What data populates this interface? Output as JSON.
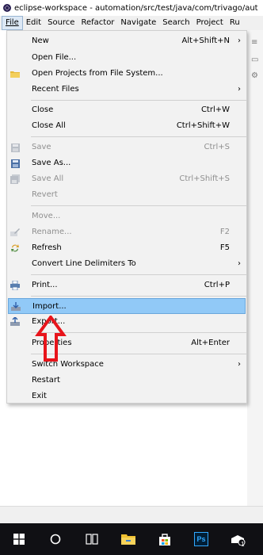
{
  "window": {
    "title": "eclipse-workspace - automation/src/test/java/com/trivago/aut"
  },
  "menubar": {
    "items": [
      "File",
      "Edit",
      "Source",
      "Refactor",
      "Navigate",
      "Search",
      "Project",
      "Ru"
    ]
  },
  "file_menu": {
    "items": [
      {
        "label": "New",
        "shortcut": "Alt+Shift+N",
        "submenu": true,
        "enabled": true
      },
      {
        "label": "Open File...",
        "shortcut": "",
        "enabled": true
      },
      {
        "label": "Open Projects from File System...",
        "shortcut": "",
        "enabled": true,
        "icon": "folder-icon"
      },
      {
        "label": "Recent Files",
        "shortcut": "",
        "submenu": true,
        "enabled": true
      },
      {
        "label": "Close",
        "shortcut": "Ctrl+W",
        "enabled": true
      },
      {
        "label": "Close All",
        "shortcut": "Ctrl+Shift+W",
        "enabled": true
      },
      {
        "label": "Save",
        "shortcut": "Ctrl+S",
        "enabled": false,
        "icon": "save-icon"
      },
      {
        "label": "Save As...",
        "shortcut": "",
        "enabled": true,
        "icon": "save-as-icon"
      },
      {
        "label": "Save All",
        "shortcut": "Ctrl+Shift+S",
        "enabled": false,
        "icon": "save-all-icon"
      },
      {
        "label": "Revert",
        "shortcut": "",
        "enabled": false
      },
      {
        "label": "Move...",
        "shortcut": "",
        "enabled": false
      },
      {
        "label": "Rename...",
        "shortcut": "F2",
        "enabled": false,
        "icon": "rename-icon"
      },
      {
        "label": "Refresh",
        "shortcut": "F5",
        "enabled": true,
        "icon": "refresh-icon"
      },
      {
        "label": "Convert Line Delimiters To",
        "shortcut": "",
        "submenu": true,
        "enabled": true
      },
      {
        "label": "Print...",
        "shortcut": "Ctrl+P",
        "enabled": true,
        "icon": "print-icon"
      },
      {
        "label": "Import...",
        "shortcut": "",
        "enabled": true,
        "highlighted": true,
        "icon": "import-icon"
      },
      {
        "label": "Export...",
        "shortcut": "",
        "enabled": true,
        "icon": "export-icon"
      },
      {
        "label": "Properties",
        "shortcut": "Alt+Enter",
        "enabled": true
      },
      {
        "label": "Switch Workspace",
        "shortcut": "",
        "submenu": true,
        "enabled": true
      },
      {
        "label": "Restart",
        "shortcut": "",
        "enabled": true
      },
      {
        "label": "Exit",
        "shortcut": "",
        "enabled": true
      }
    ],
    "submenu_arrow": "›"
  },
  "colors": {
    "highlight": "#91c9f7",
    "arrow": "#e8141b",
    "taskbar": "#101014"
  },
  "taskbar": {
    "icons": [
      "windows-start-icon",
      "search-circle-icon",
      "task-view-icon",
      "file-explorer-icon",
      "store-icon",
      "photoshop-icon",
      "eclipse-icon"
    ],
    "photoshop_text": "Ps",
    "badge": "1"
  }
}
